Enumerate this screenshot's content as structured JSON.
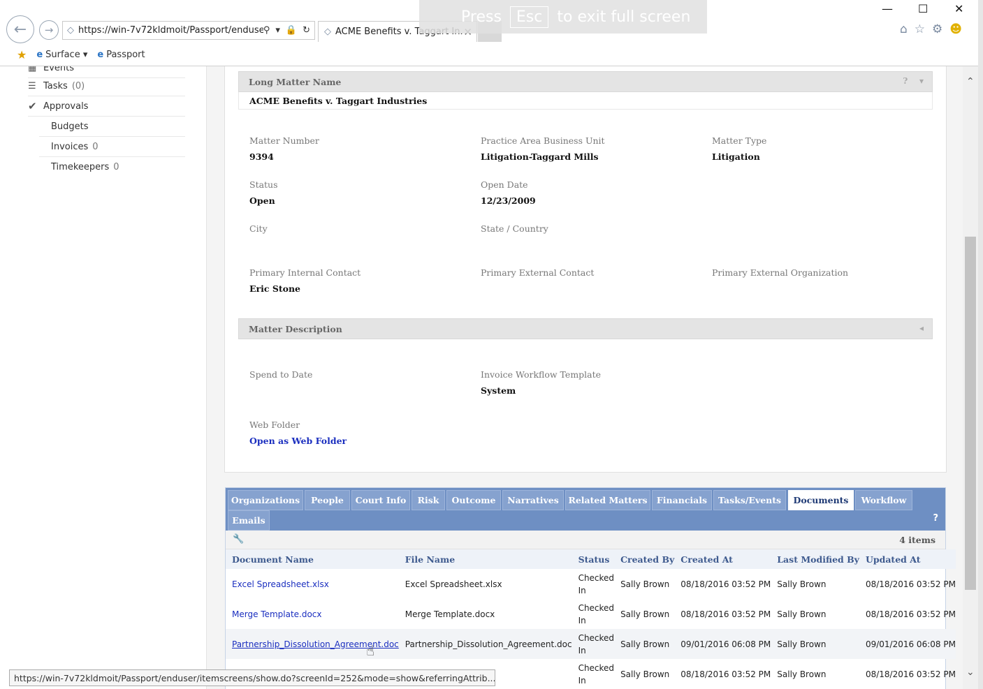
{
  "browser": {
    "url": "https://win-7v72kldmoit/Passport/enduse",
    "tab_title": "ACME Benefits v. Taggart In...",
    "fullscreen_note": {
      "press": "Press",
      "key": "Esc",
      "rest": "to exit full screen"
    },
    "favorites": [
      {
        "label": "Surface",
        "dropdown": true
      },
      {
        "label": "Passport"
      }
    ],
    "status_url": "https://win-7v72kldmoit/Passport/enduser/itemscreens/show.do?screenId=252&mode=show&referringAttrib..."
  },
  "sidebar": {
    "items": [
      {
        "label": "Events",
        "count": ""
      },
      {
        "label": "Tasks",
        "count": "(0)"
      },
      {
        "label": "Approvals",
        "count": ""
      },
      {
        "label": "Budgets",
        "count": ""
      },
      {
        "label": "Invoices",
        "count": "0"
      },
      {
        "label": "Timekeepers",
        "count": "0"
      }
    ]
  },
  "matter": {
    "long_name_header": "Long Matter Name",
    "long_name": "ACME Benefits v. Taggart Industries",
    "description_header": "Matter Description",
    "fields": {
      "matter_number": {
        "label": "Matter Number",
        "value": "9394"
      },
      "practice_area": {
        "label": "Practice Area Business Unit",
        "value": "Litigation-Taggard Mills"
      },
      "matter_type": {
        "label": "Matter Type",
        "value": "Litigation"
      },
      "status": {
        "label": "Status",
        "value": "Open"
      },
      "open_date": {
        "label": "Open Date",
        "value": "12/23/2009"
      },
      "city": {
        "label": "City",
        "value": ""
      },
      "state_country": {
        "label": "State / Country",
        "value": ""
      },
      "primary_internal": {
        "label": "Primary Internal Contact",
        "value": "Eric Stone"
      },
      "primary_external": {
        "label": "Primary External Contact",
        "value": ""
      },
      "primary_external_org": {
        "label": "Primary External Organization",
        "value": ""
      },
      "spend_to_date": {
        "label": "Spend to Date",
        "value": ""
      },
      "invoice_template": {
        "label": "Invoice Workflow Template",
        "value": "System"
      },
      "web_folder": {
        "label": "Web Folder",
        "value": "Open as Web Folder"
      }
    }
  },
  "tabs": {
    "items": [
      "Organizations",
      "People",
      "Court Info",
      "Risk",
      "Outcome",
      "Narratives",
      "Related Matters",
      "Financials",
      "Tasks/Events",
      "Documents",
      "Workflow",
      "Emails"
    ],
    "active": "Documents",
    "help": "?",
    "item_count": "4 items"
  },
  "documents": {
    "columns": [
      "Document Name",
      "File Name",
      "Status",
      "Created By",
      "Created At",
      "Last Modified By",
      "Updated At"
    ],
    "rows": [
      {
        "name": "Excel Spreadsheet.xlsx",
        "file": "Excel Spreadsheet.xlsx",
        "status1": "Checked",
        "status2": "In",
        "created_by": "Sally Brown",
        "created_at": "08/18/2016 03:52 PM",
        "modified_by": "Sally Brown",
        "updated_at": "08/18/2016 03:52 PM"
      },
      {
        "name": "Merge Template.docx",
        "file": "Merge Template.docx",
        "status1": "Checked",
        "status2": "In",
        "created_by": "Sally Brown",
        "created_at": "08/18/2016 03:52 PM",
        "modified_by": "Sally Brown",
        "updated_at": "08/18/2016 03:52 PM"
      },
      {
        "name": "Partnership_Dissolution_Agreement.doc",
        "file": "Partnership_Dissolution_Agreement.doc",
        "status1": "Checked",
        "status2": "In",
        "created_by": "Sally Brown",
        "created_at": "09/01/2016 06:08 PM",
        "modified_by": "Sally Brown",
        "updated_at": "09/01/2016 06:08 PM"
      },
      {
        "name": "",
        "file": "",
        "status1": "Checked",
        "status2": "In",
        "created_by": "Sally Brown",
        "created_at": "08/18/2016 03:52 PM",
        "modified_by": "Sally Brown",
        "updated_at": "08/18/2016 03:52 PM"
      }
    ]
  },
  "colors": {
    "tab_strip": "#6e8fc3",
    "link": "#1a2ebf",
    "header_text": "#3e5a8e"
  }
}
